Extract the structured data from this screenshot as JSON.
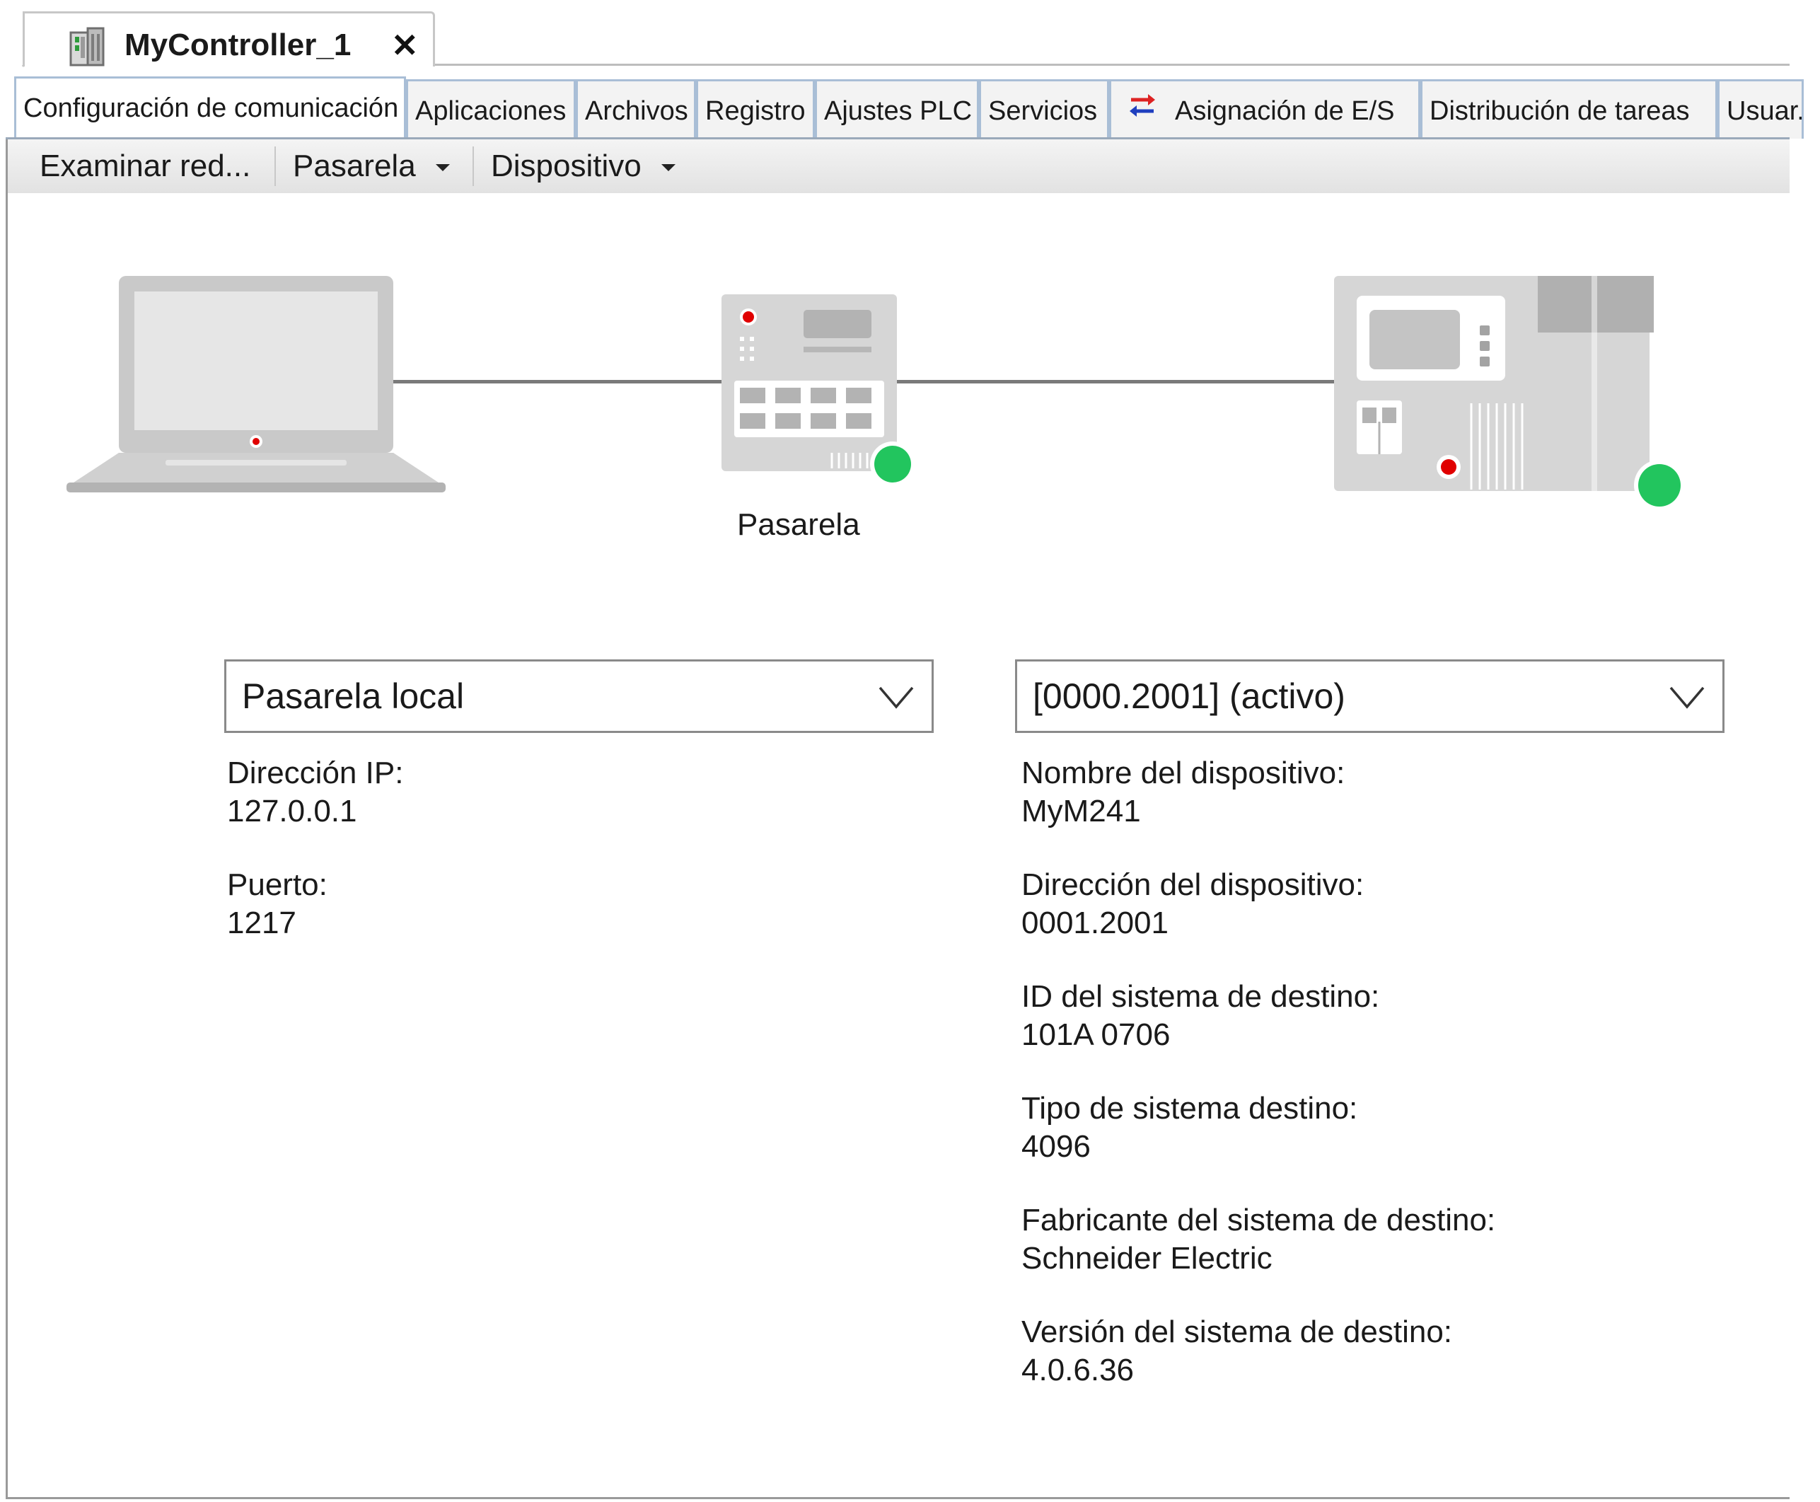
{
  "document_tab": {
    "title": "MyController_1",
    "close_glyph": "✕"
  },
  "subtabs": [
    {
      "label": "Configuración de comunicación"
    },
    {
      "label": "Aplicaciones"
    },
    {
      "label": "Archivos"
    },
    {
      "label": "Registro"
    },
    {
      "label": "Ajustes PLC"
    },
    {
      "label": "Servicios"
    },
    {
      "label": "Asignación de E/S",
      "icon": "swap-arrows-icon"
    },
    {
      "label": "Distribución de tareas"
    },
    {
      "label": "Usuar."
    }
  ],
  "toolbar": {
    "scan_network": "Examinar red...",
    "gateway_menu": "Pasarela",
    "device_menu": "Dispositivo"
  },
  "diagram": {
    "gateway_caption": "Pasarela",
    "status_color": "#22c55e",
    "indicator_color": "#e00000"
  },
  "gateway_panel": {
    "selected": "Pasarela local",
    "fields": [
      {
        "label": "Dirección IP:",
        "value": "127.0.0.1"
      },
      {
        "label": "Puerto:",
        "value": "1217"
      }
    ]
  },
  "device_panel": {
    "selected": "[0000.2001] (activo)",
    "fields": [
      {
        "label": "Nombre del dispositivo:",
        "value": "MyM241"
      },
      {
        "label": "Dirección del dispositivo:",
        "value": "0001.2001"
      },
      {
        "label": "ID del sistema de destino:",
        "value": "101A 0706"
      },
      {
        "label": "Tipo de sistema destino:",
        "value": "4096"
      },
      {
        "label": "Fabricante del sistema de destino:",
        "value": "Schneider Electric"
      },
      {
        "label": "Versión del sistema de destino:",
        "value": "4.0.6.36"
      }
    ]
  }
}
